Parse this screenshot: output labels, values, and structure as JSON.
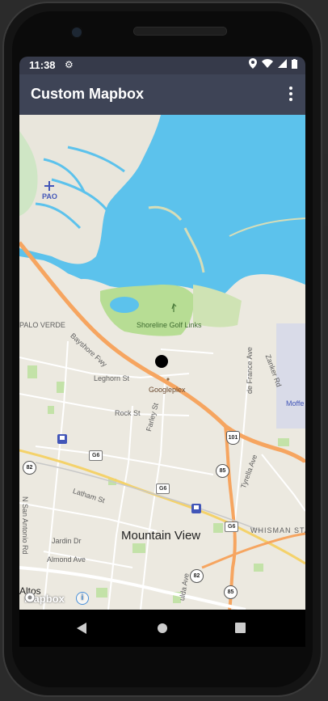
{
  "status": {
    "time": "11:38"
  },
  "toolbar": {
    "title": "Custom Mapbox"
  },
  "map": {
    "labels": {
      "pao": "PAO",
      "palo_verde": "PALO VERDE",
      "bayshore": "Bayshore Fwy",
      "golf": "Shoreline Golf Links",
      "leghorn": "Leghorn St",
      "googleplex": "Googleplex",
      "defrance": "de France Ave",
      "zanker": "Zanker Rd",
      "moffett": "Moffe",
      "rock": "Rock St",
      "farley": "Farley St",
      "latham": "Latham St",
      "san_antonio": "N San Antonio Rd",
      "jardin": "Jardin Dr",
      "almond": "Almond Ave",
      "tyrella": "Tyrella Ave",
      "whisman": "WHISMAN STATION",
      "mountain_view": "Mountain View",
      "altos": "Altos",
      "ulda": "ulda Ave"
    },
    "shields": {
      "r82a": "82",
      "r82b": "82",
      "r101": "101",
      "r85a": "85",
      "r85b": "85",
      "g6a": "G6",
      "g6b": "G6",
      "g6c": "G6"
    },
    "attribution": "mapbox",
    "info": "i"
  }
}
